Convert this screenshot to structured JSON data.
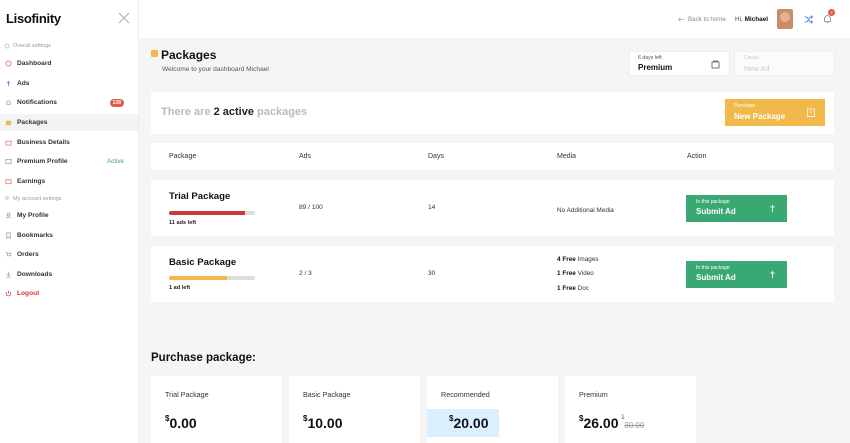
{
  "sidebar": {
    "logo": "Lisofinity",
    "sections": [
      "Overall settings",
      "My account settings"
    ],
    "items": [
      {
        "label": "Dashboard"
      },
      {
        "label": "Ads"
      },
      {
        "label": "Notifications",
        "badge": "138"
      },
      {
        "label": "Packages"
      },
      {
        "label": "Business Details"
      },
      {
        "label": "Premium Profile",
        "status": "Active"
      },
      {
        "label": "Earnings"
      },
      {
        "label": "My Profile"
      },
      {
        "label": "Bookmarks"
      },
      {
        "label": "Orders"
      },
      {
        "label": "Downloads"
      },
      {
        "label": "Logout"
      }
    ]
  },
  "topbar": {
    "back_label": "Back to home",
    "greeting": "Hi,",
    "user_name": "Michael",
    "bell_badge": "2"
  },
  "header": {
    "title": "Packages",
    "subtitle": "Welcome to your dashboard Michael",
    "plan_days": "6 days left",
    "plan_name": "Premium",
    "new_ad_small": "Create",
    "new_ad_label": "New Ad"
  },
  "banner": {
    "prefix": "There are",
    "count": "2 active",
    "suffix": "packages",
    "purchase_small": "Purchase",
    "purchase_label": "New Package"
  },
  "table": {
    "headers": [
      "Package",
      "Ads",
      "Days",
      "Media",
      "Action"
    ],
    "rows": [
      {
        "name": "Trial Package",
        "progress": 0.88,
        "progress_color": "#c9383a",
        "left_text": "11 ads left",
        "ads": "89 / 100",
        "days": "14",
        "media": [
          "No Additional Media"
        ],
        "action_small": "In this package",
        "action_label": "Submit Ad"
      },
      {
        "name": "Basic Package",
        "progress": 0.67,
        "progress_color": "#f0b94a",
        "left_text": "1 ad left",
        "ads": "2 / 3",
        "days": "30",
        "media": [
          {
            "count": "4 Free",
            "type": "Images"
          },
          {
            "count": "1 Free",
            "type": "Video"
          },
          {
            "count": "1 Free",
            "type": "Doc"
          }
        ],
        "action_small": "In this package",
        "action_label": "Submit Ad"
      }
    ]
  },
  "purchase": {
    "title": "Purchase package:",
    "cards": [
      {
        "name": "Trial Package",
        "currency": "$",
        "price": "0.00"
      },
      {
        "name": "Basic Package",
        "currency": "$",
        "price": "10.00"
      },
      {
        "name": "Recommended",
        "currency": "$",
        "price": "20.00"
      },
      {
        "name": "Premium",
        "currency": "$",
        "price": "26.00",
        "old_currency": "$",
        "old_price": "30.00"
      }
    ]
  },
  "colors": {
    "accent_yellow": "#f0b94a",
    "accent_green": "#3aa873",
    "badge_red": "#e05a4a"
  }
}
